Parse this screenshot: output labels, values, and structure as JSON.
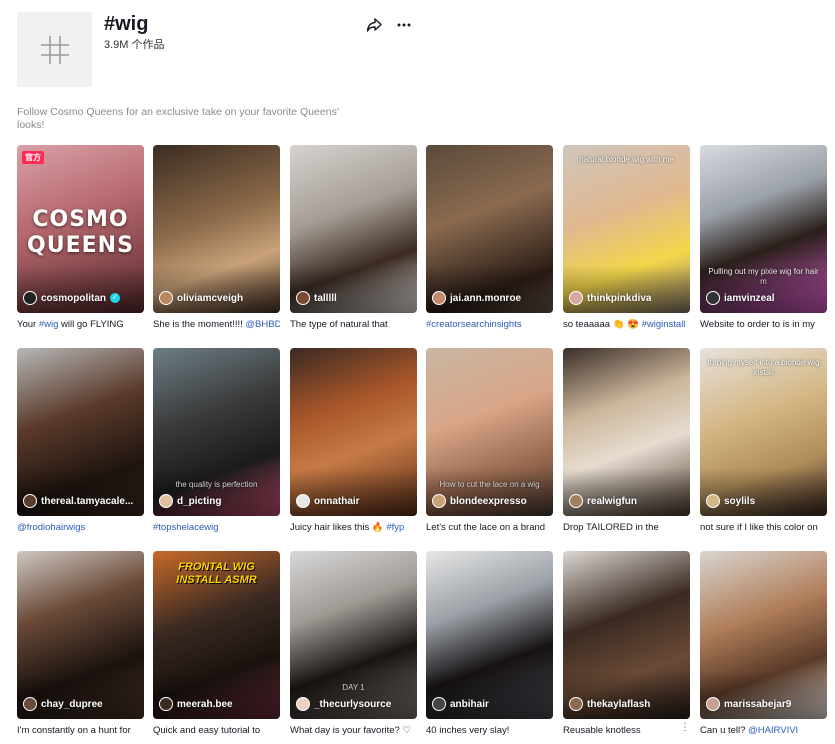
{
  "header": {
    "title": "#wig",
    "count": "3.9M 个作品",
    "avatar_icon": "hashtag-icon",
    "share_icon": "share-arrow-icon",
    "more_icon": "more-dots-icon"
  },
  "description": "Follow Cosmo Queens for an exclusive take on your favorite Queens' looks!",
  "videos": [
    {
      "author": "cosmopolitan",
      "verified": true,
      "official_badge": "官方",
      "cover_title": "COSMO QUEENS",
      "caption_pre": "Your ",
      "caption_tag": "#wig",
      "caption_post": " will go FLYING"
    },
    {
      "author": "oliviamcveigh",
      "caption_pre": "She is the moment!!!! ",
      "caption_tag": "@BHBD",
      "caption_post": ""
    },
    {
      "author": "talllll",
      "caption_pre": "The type of natural that",
      "caption_tag": "",
      "caption_post": ""
    },
    {
      "author": "jai.ann.monroe",
      "caption_pre": "",
      "caption_tag": "#creatorsearchinsights",
      "caption_post": ""
    },
    {
      "author": "thinkpinkdiva",
      "overlay_top": "natural blonde wig with me",
      "caption_pre": "so teaaaaa 👏 😍 ",
      "caption_tag": "#wiginstall",
      "caption_post": ""
    },
    {
      "author": "iamvinzeal",
      "overlay_bottom": "Pulling out my pixie wig for hair m",
      "caption_pre": "Website to order to is in my",
      "caption_tag": "",
      "caption_post": ""
    },
    {
      "author": "thereal.tamyacale...",
      "caption_pre": "",
      "caption_tag": "@frodiohairwigs",
      "caption_post": ""
    },
    {
      "author": "d_picting",
      "overlay_bottom": "the quality is perfection",
      "caption_pre": "",
      "caption_tag": "#topshelacewig",
      "caption_post": ""
    },
    {
      "author": "onnathair",
      "caption_pre": "Juicy hair likes this 🔥 ",
      "caption_tag": "#fyp",
      "caption_post": ""
    },
    {
      "author": "blondeexpresso",
      "overlay_bottom": "How to cut the lace on a wig",
      "caption_pre": "Let's cut the lace on a brand",
      "caption_tag": "",
      "caption_post": ""
    },
    {
      "author": "realwigfun",
      "caption_pre": "Drop TAILORED in the",
      "caption_tag": "",
      "caption_post": ""
    },
    {
      "author": "soylils",
      "overlay_top": "turning myself into a blonde wig install",
      "caption_pre": "not sure if I like this color on",
      "caption_tag": "",
      "caption_post": ""
    },
    {
      "author": "chay_dupree",
      "caption_pre": "I'm constantly on a hunt for",
      "caption_tag": "",
      "caption_post": ""
    },
    {
      "author": "meerah.bee",
      "banner": "FRONTAL WIG INSTALL ASMR",
      "caption_pre": "Quick and easy tutorial to",
      "caption_tag": "",
      "caption_post": ""
    },
    {
      "author": "_thecurlysource",
      "overlay_bottom": "DAY 1",
      "caption_pre": "What day is your favorite? ♡",
      "caption_tag": "",
      "caption_post": ""
    },
    {
      "author": "anbihair",
      "caption_pre": "40 inches very slay!",
      "caption_tag": "",
      "caption_post": ""
    },
    {
      "author": "thekaylaflash",
      "caption_pre": "Reusable knotless",
      "caption_tag": "",
      "caption_post": ""
    },
    {
      "author": "marissabejar9",
      "caption_pre": "Can u tell? ",
      "caption_tag": "@HAIRVIVI",
      "caption_post": ""
    }
  ],
  "colors": {
    "hashtag_link": "#2b5db9",
    "official_badge": "#fe2c55",
    "verified": "#20d5ec",
    "description_text": "#8a8b91"
  }
}
